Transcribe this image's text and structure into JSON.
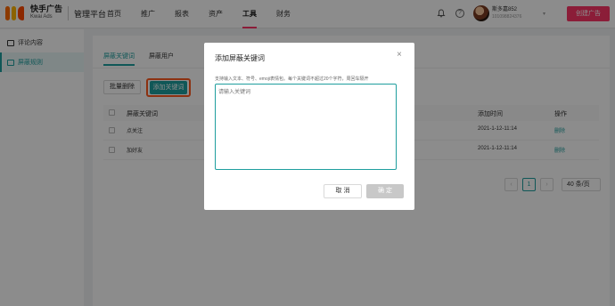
{
  "brand": {
    "name_cn": "快手广告",
    "name_en": "Kwai Ads",
    "product": "管理平台"
  },
  "nav": {
    "items": [
      {
        "label": "首页",
        "active": false
      },
      {
        "label": "推广",
        "active": false
      },
      {
        "label": "报表",
        "active": false
      },
      {
        "label": "资产",
        "active": false
      },
      {
        "label": "工具",
        "active": true
      },
      {
        "label": "财务",
        "active": false
      }
    ]
  },
  "header": {
    "help_glyph": "?",
    "user_name": "斯多嘉852",
    "user_id": "101098824376",
    "dropdown_glyph": "▾",
    "create_button": "创建广告"
  },
  "sidebar": {
    "items": [
      {
        "label": "评论内容",
        "icon": "comment-icon",
        "active": false
      },
      {
        "label": "屏蔽规则",
        "icon": "block-rule-icon",
        "active": true
      }
    ]
  },
  "main": {
    "tabs": [
      {
        "label": "屏蔽关键词",
        "active": true
      },
      {
        "label": "屏蔽用户",
        "active": false
      }
    ],
    "batch_delete": "批量删除",
    "add_keyword": "添加关键词",
    "columns": {
      "keyword": "屏蔽关键词",
      "time": "添加时间",
      "action": "操作"
    },
    "rows": [
      {
        "keyword": "点关注",
        "time": "2021-1-12-11:14",
        "action": "删除"
      },
      {
        "keyword": "加好友",
        "time": "2021-1-12-11:14",
        "action": "删除"
      }
    ],
    "pagination": {
      "prev": "‹",
      "current": "1",
      "next": "›",
      "page_size": "40 条/页"
    }
  },
  "modal": {
    "title": "添加屏蔽关键词",
    "close_glyph": "×",
    "hint": "支持输入文本、符号、emoji表情包。每个关键词不超过20个字符，周回车隔开",
    "placeholder": "请输入关键词",
    "cancel": "取 消",
    "confirm": "确 定"
  },
  "colors": {
    "accent": "#1e9e9e",
    "brand": "#fe3666",
    "highlight": "#ff5a1f"
  }
}
